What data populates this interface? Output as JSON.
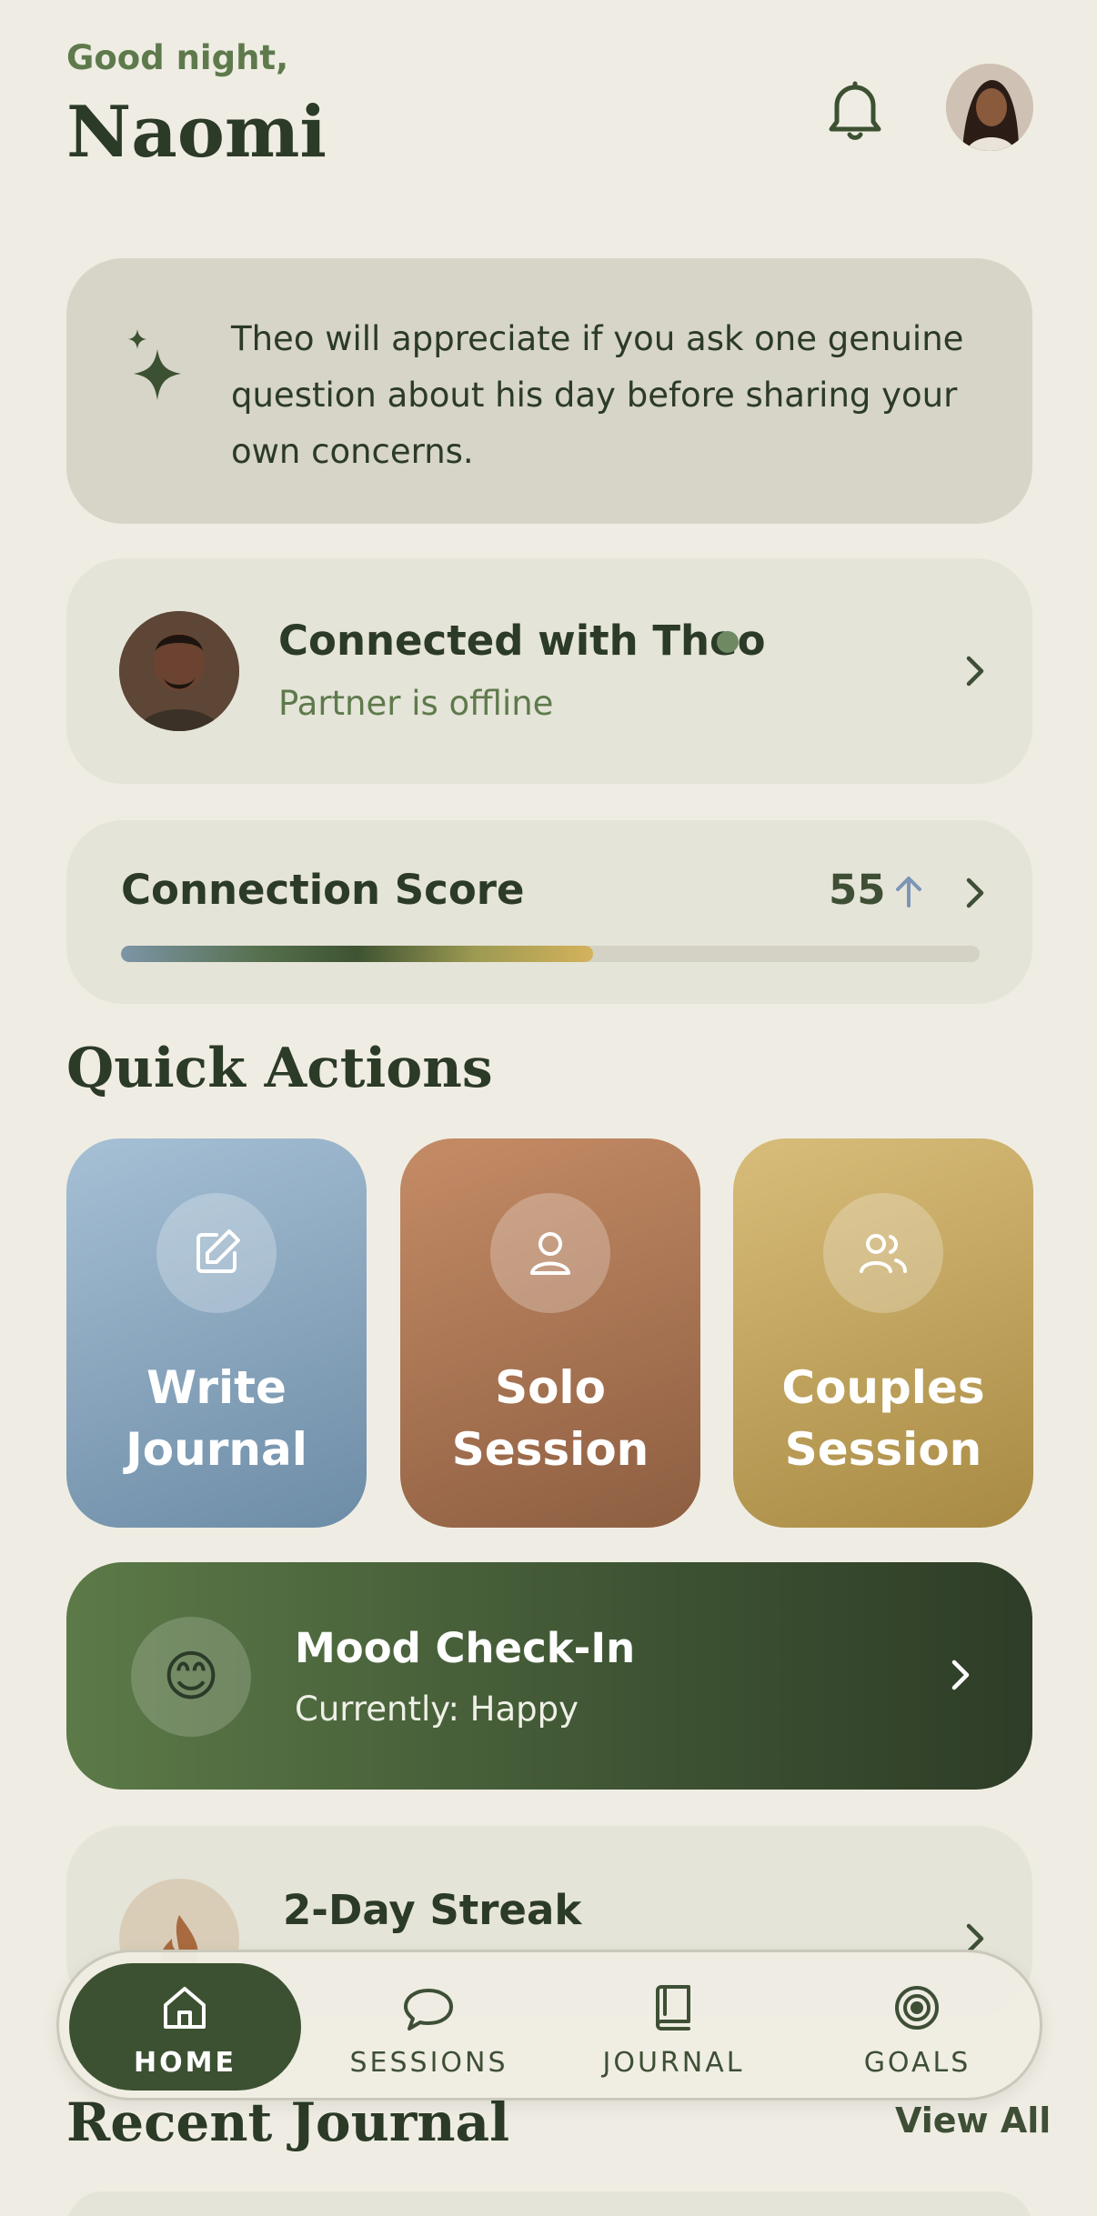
{
  "header": {
    "greeting": "Good night,",
    "name": "Naomi"
  },
  "tip": {
    "text": "Theo will appreciate if you ask one genuine question about his day before sharing your own concerns."
  },
  "partner": {
    "title": "Connected with Theo",
    "status": "Partner is offline"
  },
  "score": {
    "title": "Connection Score",
    "value": "55",
    "progress_percent": 55,
    "trend": "up"
  },
  "quick_actions": {
    "title": "Quick Actions",
    "items": [
      {
        "label_line1": "Write",
        "label_line2": "Journal",
        "icon": "edit-icon",
        "color": "#8fabc3"
      },
      {
        "label_line1": "Solo",
        "label_line2": "Session",
        "icon": "person-icon",
        "color": "#a87452"
      },
      {
        "label_line1": "Couples",
        "label_line2": "Session",
        "icon": "people-icon",
        "color": "#c4a55e"
      }
    ]
  },
  "mood": {
    "title": "Mood Check-In",
    "current": "Currently: Happy",
    "emoji": "😊"
  },
  "streak": {
    "title": "2-Day Streak"
  },
  "nav": {
    "items": [
      {
        "label": "HOME",
        "icon": "home-icon",
        "active": true
      },
      {
        "label": "SESSIONS",
        "icon": "chat-bubble-icon",
        "active": false
      },
      {
        "label": "JOURNAL",
        "icon": "book-icon",
        "active": false
      },
      {
        "label": "GOALS",
        "icon": "target-icon",
        "active": false
      }
    ]
  },
  "recent_journal": {
    "title": "Recent Journal",
    "view_all": "View All"
  },
  "colors": {
    "background": "#efede3",
    "primary_green": "#3c5131",
    "accent_green": "#5e7a4c"
  }
}
